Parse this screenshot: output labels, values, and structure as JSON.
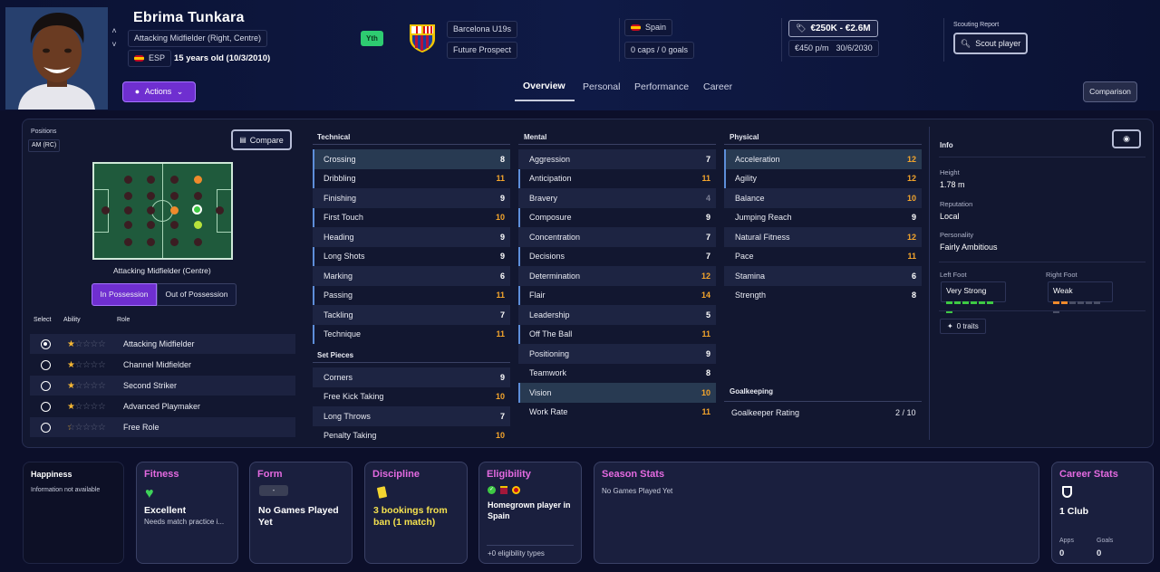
{
  "player": {
    "name": "Ebrima Tunkara",
    "position": "Attacking Midfielder (Right, Centre)",
    "nation_code": "ESP",
    "age": "15 years old (10/3/2010)",
    "youth_badge": "Yth",
    "club": "Barcelona U19s",
    "status": "Future Prospect",
    "nation": "Spain",
    "caps": "0 caps / 0 goals",
    "value": "€250K - €2.6M",
    "wage": "€450 p/m",
    "contract": "30/6/2030",
    "scouting_label": "Scouting Report",
    "scout_button": "Scout player",
    "actions_button": "Actions",
    "comparison_button": "Comparison"
  },
  "tabs": [
    "Overview",
    "Personal",
    "Performance",
    "Career"
  ],
  "positions": {
    "label": "Positions",
    "current": "AM (RC)",
    "compare_button": "Compare",
    "pitch_caption": "Attacking Midfielder (Centre)",
    "toggle": [
      "In Possession",
      "Out of Possession"
    ],
    "headers": [
      "Select",
      "Ability",
      "Role"
    ],
    "roles": [
      {
        "name": "Attacking Midfielder",
        "stars": 1,
        "selected": true
      },
      {
        "name": "Channel Midfielder",
        "stars": 1,
        "selected": false
      },
      {
        "name": "Second Striker",
        "stars": 1,
        "selected": false
      },
      {
        "name": "Advanced Playmaker",
        "stars": 1,
        "selected": false
      },
      {
        "name": "Free Role",
        "stars": 0.5,
        "selected": false
      }
    ]
  },
  "technical": {
    "title": "Technical",
    "attrs": [
      {
        "name": "Crossing",
        "value": "8",
        "tone": "w",
        "hl": true
      },
      {
        "name": "Dribbling",
        "value": "11",
        "tone": "o",
        "hl": true
      },
      {
        "name": "Finishing",
        "value": "9",
        "tone": "w",
        "hl": false
      },
      {
        "name": "First Touch",
        "value": "10",
        "tone": "o",
        "hl": true
      },
      {
        "name": "Heading",
        "value": "9",
        "tone": "w",
        "hl": false
      },
      {
        "name": "Long Shots",
        "value": "9",
        "tone": "w",
        "hl": true
      },
      {
        "name": "Marking",
        "value": "6",
        "tone": "w",
        "hl": false
      },
      {
        "name": "Passing",
        "value": "11",
        "tone": "o",
        "hl": true
      },
      {
        "name": "Tackling",
        "value": "7",
        "tone": "w",
        "hl": false
      },
      {
        "name": "Technique",
        "value": "11",
        "tone": "o",
        "hl": true
      }
    ]
  },
  "set_pieces": {
    "title": "Set Pieces",
    "attrs": [
      {
        "name": "Corners",
        "value": "9",
        "tone": "w"
      },
      {
        "name": "Free Kick Taking",
        "value": "10",
        "tone": "o"
      },
      {
        "name": "Long Throws",
        "value": "7",
        "tone": "w"
      },
      {
        "name": "Penalty Taking",
        "value": "10",
        "tone": "o"
      }
    ]
  },
  "mental": {
    "title": "Mental",
    "attrs": [
      {
        "name": "Aggression",
        "value": "7",
        "tone": "w",
        "hl": false
      },
      {
        "name": "Anticipation",
        "value": "11",
        "tone": "o",
        "hl": true
      },
      {
        "name": "Bravery",
        "value": "4",
        "tone": "g",
        "hl": false
      },
      {
        "name": "Composure",
        "value": "9",
        "tone": "w",
        "hl": true
      },
      {
        "name": "Concentration",
        "value": "7",
        "tone": "w",
        "hl": false
      },
      {
        "name": "Decisions",
        "value": "7",
        "tone": "w",
        "hl": true
      },
      {
        "name": "Determination",
        "value": "12",
        "tone": "o",
        "hl": false
      },
      {
        "name": "Flair",
        "value": "14",
        "tone": "o",
        "hl": true
      },
      {
        "name": "Leadership",
        "value": "5",
        "tone": "w",
        "hl": false
      },
      {
        "name": "Off The Ball",
        "value": "11",
        "tone": "o",
        "hl": true
      },
      {
        "name": "Positioning",
        "value": "9",
        "tone": "w",
        "hl": false
      },
      {
        "name": "Teamwork",
        "value": "8",
        "tone": "w",
        "hl": false
      },
      {
        "name": "Vision",
        "value": "10",
        "tone": "o",
        "hl": true
      },
      {
        "name": "Work Rate",
        "value": "11",
        "tone": "o",
        "hl": false
      }
    ]
  },
  "physical": {
    "title": "Physical",
    "attrs": [
      {
        "name": "Acceleration",
        "value": "12",
        "tone": "o",
        "hl": true
      },
      {
        "name": "Agility",
        "value": "12",
        "tone": "o",
        "hl": true
      },
      {
        "name": "Balance",
        "value": "10",
        "tone": "o",
        "hl": false
      },
      {
        "name": "Jumping Reach",
        "value": "9",
        "tone": "w",
        "hl": false
      },
      {
        "name": "Natural Fitness",
        "value": "12",
        "tone": "o",
        "hl": false
      },
      {
        "name": "Pace",
        "value": "11",
        "tone": "o",
        "hl": false
      },
      {
        "name": "Stamina",
        "value": "6",
        "tone": "w",
        "hl": false
      },
      {
        "name": "Strength",
        "value": "8",
        "tone": "w",
        "hl": false
      }
    ]
  },
  "goalkeeping": {
    "title": "Goalkeeping",
    "label": "Goalkeeper Rating",
    "value": "2 / 10"
  },
  "info": {
    "title": "Info",
    "height_label": "Height",
    "height": "1.78 m",
    "reputation_label": "Reputation",
    "reputation": "Local",
    "personality_label": "Personality",
    "personality": "Fairly Ambitious",
    "left_foot_label": "Left Foot",
    "left_foot": "Very Strong",
    "left_foot_level": 7,
    "right_foot_label": "Right Foot",
    "right_foot": "Weak",
    "right_foot_level": 2,
    "foot_max": 7,
    "traits": "0 traits"
  },
  "cards": {
    "happiness": {
      "title": "Happiness",
      "text": "Information not available"
    },
    "fitness": {
      "title": "Fitness",
      "status": "Excellent",
      "note": "Needs match practice i..."
    },
    "form": {
      "title": "Form",
      "badge": "-",
      "text": "No Games Played Yet"
    },
    "discipline": {
      "title": "Discipline",
      "text": "3 bookings from ban (1 match)"
    },
    "eligibility": {
      "title": "Eligibility",
      "text": "Homegrown player in Spain",
      "footer": "+0 eligibility types"
    },
    "season": {
      "title": "Season Stats",
      "text": "No Games Played Yet"
    },
    "career": {
      "title": "Career Stats",
      "clubs": "1 Club",
      "apps_label": "Apps",
      "apps": "0",
      "goals_label": "Goals",
      "goals": "0"
    }
  },
  "colors": {
    "accent": "#6f2fd0",
    "highlight_orange": "#f4a52c",
    "card_title": "#e36ae0",
    "green_dot": "#3ec944"
  }
}
